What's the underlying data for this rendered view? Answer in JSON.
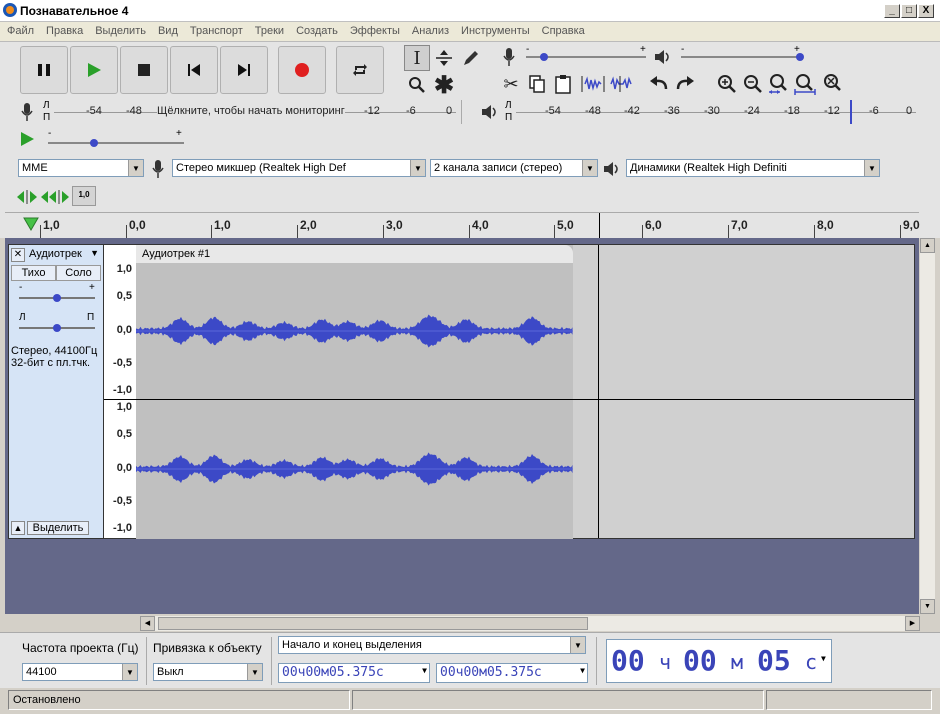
{
  "window": {
    "title": "Познавательное 4",
    "min": "_",
    "max": "□",
    "close": "X"
  },
  "menu": [
    "Файл",
    "Правка",
    "Выделить",
    "Вид",
    "Транспорт",
    "Треки",
    "Создать",
    "Эффекты",
    "Анализ",
    "Инструменты",
    "Справка"
  ],
  "meters": {
    "rec_ticks": [
      "-54",
      "-48",
      "-12",
      "-6",
      "0"
    ],
    "rec_prompt": "Щёлкните, чтобы начать мониторинг",
    "play_ticks": [
      "-54",
      "-48",
      "-42",
      "-36",
      "-30",
      "-24",
      "-18",
      "-12",
      "-6",
      "0"
    ],
    "left": "Л",
    "right": "П",
    "minus": "-",
    "plus": "+"
  },
  "devices": {
    "host": "MME",
    "input": "Стерео микшер (Realtek High Def",
    "channels": "2  канала записи (стерео)",
    "output": "Динамики (Realtek High Definiti"
  },
  "scrub_label": "1,0",
  "timeline": [
    "1,0",
    "0,0",
    "1,0",
    "2,0",
    "3,0",
    "4,0",
    "5,0",
    "6,0",
    "7,0",
    "8,0",
    "9,0"
  ],
  "track": {
    "name": "Аудиотрек",
    "clip_name": "Аудиотрек #1",
    "mute": "Тихо",
    "solo": "Соло",
    "gain_minus": "-",
    "gain_plus": "+",
    "pan_left": "Л",
    "pan_right": "П",
    "info1": "Стерео, 44100Гц",
    "info2": "32-бит с пл.тчк.",
    "select": "Выделить",
    "close": "✕",
    "scale": [
      "1,0",
      "0,5",
      "0,0",
      "-0,5",
      "-1,0"
    ]
  },
  "selection_bar": {
    "rate_label": "Частота проекта (Гц)",
    "rate_value": "44100",
    "snap_label": "Привязка к объекту",
    "snap_value": "Выкл",
    "mode": "Начало и конец выделения",
    "start": "00ч00м05.375с",
    "end": "00ч00м05.375с"
  },
  "time": {
    "h": "00",
    "hu": "ч",
    "m": "00",
    "mu": "м",
    "s": "05",
    "su": "с"
  },
  "status": {
    "text": "Остановлено"
  },
  "colors": {
    "wave": "#3c49c7",
    "record": "#e02020",
    "play": "#2aa02a",
    "tracks_bg": "#646889"
  }
}
